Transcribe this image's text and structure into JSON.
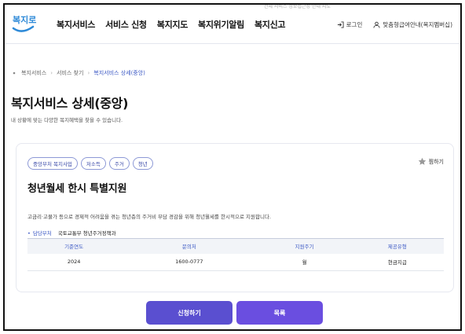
{
  "header": {
    "logo_text": "복지로",
    "nav": [
      "복지서비스",
      "서비스 신청",
      "복지지도",
      "복지위기알림",
      "복지신고"
    ],
    "util_top": "전체 서비스   정보접근성 안내   지도",
    "login": "로그인",
    "guide": "맞춤형급여안내(복지멤버십)"
  },
  "breadcrumb": {
    "items": [
      "복지서비스",
      "서비스 찾기",
      "복지서비스 상세(중앙)"
    ]
  },
  "page": {
    "title": "복지서비스 상세(중앙)",
    "subtitle": "내 상황에 맞는 다양한 복지혜택을 찾을 수 있습니다."
  },
  "card": {
    "tags": [
      "중앙부처 복지사업",
      "저소득",
      "주거",
      "청년"
    ],
    "fav_label": "찜하기",
    "service_title": "청년월세 한시 특별지원",
    "description": "고금리·고물가 등으로 경제적 어려움을 겪는 청년층의 주거비 부담 경감을 위해 청년월세를 한시적으로 지원합니다.",
    "dept_label": "담당부처",
    "dept_value": "국토교통부 청년주거정책과",
    "table": {
      "headers": [
        "기준연도",
        "문의처",
        "지원주기",
        "제공유형"
      ],
      "row": [
        "2024",
        "1600-0777",
        "월",
        "현금지급"
      ]
    }
  },
  "buttons": {
    "apply": "신청하기",
    "list": "목록"
  },
  "colors": {
    "accent": "#3a57c4",
    "button": "#5a4fd0"
  }
}
